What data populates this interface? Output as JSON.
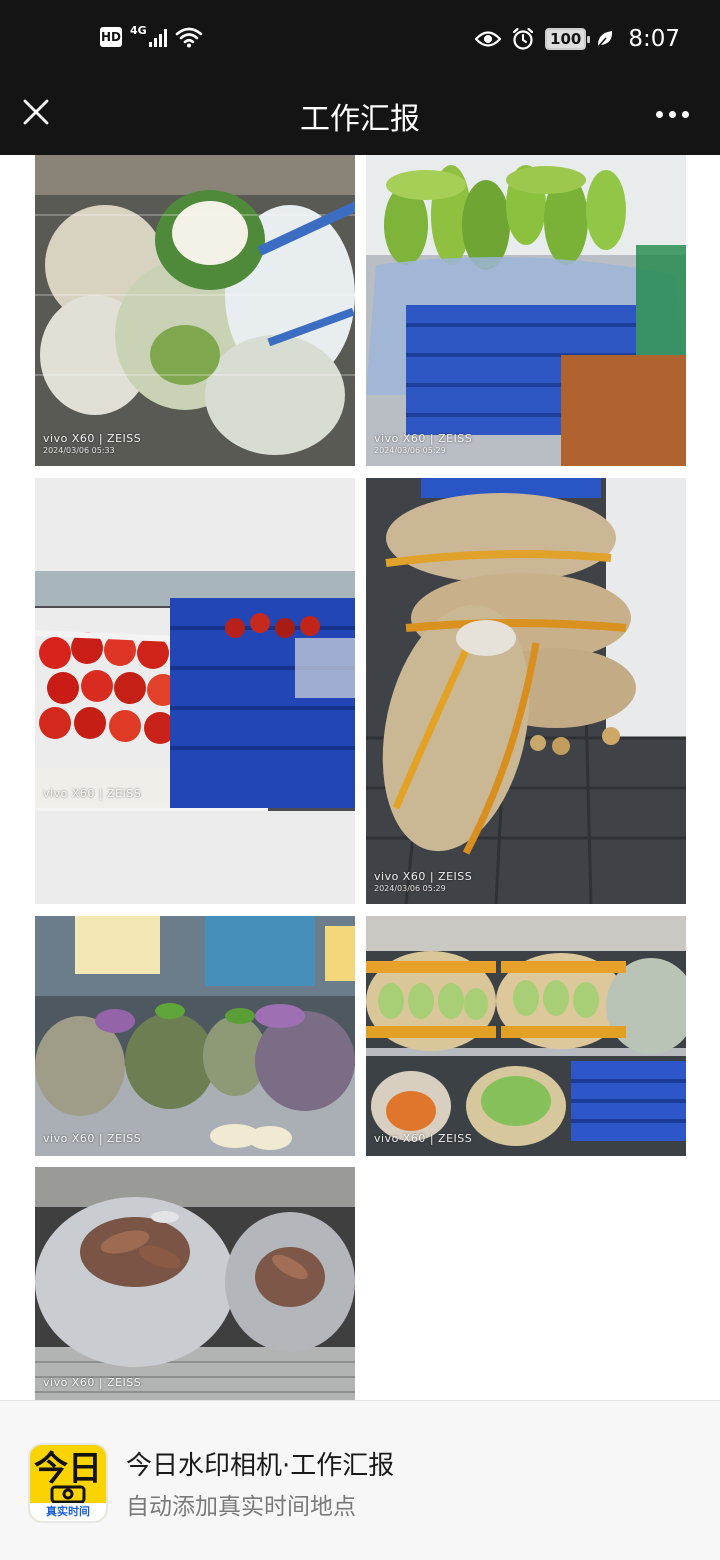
{
  "status_bar": {
    "hd_label": "HD",
    "network_type": "4G",
    "battery_level": "100",
    "time": "8:07",
    "icons": [
      "signal-icon",
      "wifi-icon",
      "eye-icon",
      "alarm-icon",
      "battery-icon",
      "leaf-icon"
    ]
  },
  "header": {
    "title": "工作汇报",
    "close_icon": "close-icon",
    "more_icon": "more-icon"
  },
  "photos": [
    {
      "subject": "cauliflower",
      "brand": "vivo X60 | ZEISS",
      "date": "2024/03/06 05:33"
    },
    {
      "subject": "zucchini",
      "brand": "vivo X60 | ZEISS",
      "date": "2024/03/06 05:29"
    },
    {
      "subject": "tomatoes",
      "brand": "vivo X60 | ZEISS",
      "date": ""
    },
    {
      "subject": "potatoes",
      "brand": "vivo X60 | ZEISS",
      "date": "2024/03/06 05:29"
    },
    {
      "subject": "leafy-greens",
      "brand": "vivo X60 | ZEISS",
      "date": ""
    },
    {
      "subject": "cabbage",
      "brand": "vivo X60 | ZEISS",
      "date": ""
    },
    {
      "subject": "sweet-potatoes",
      "brand": "vivo X60 | ZEISS",
      "date": ""
    }
  ],
  "footer": {
    "app_icon_text": "今日",
    "app_icon_caption": "真实时间",
    "title": "今日水印相机·工作汇报",
    "subtitle": "自动添加真实时间地点"
  },
  "colors": {
    "bar_background": "#141414",
    "app_icon_yellow": "#fbd300",
    "app_icon_blue": "#1b5fd8"
  }
}
